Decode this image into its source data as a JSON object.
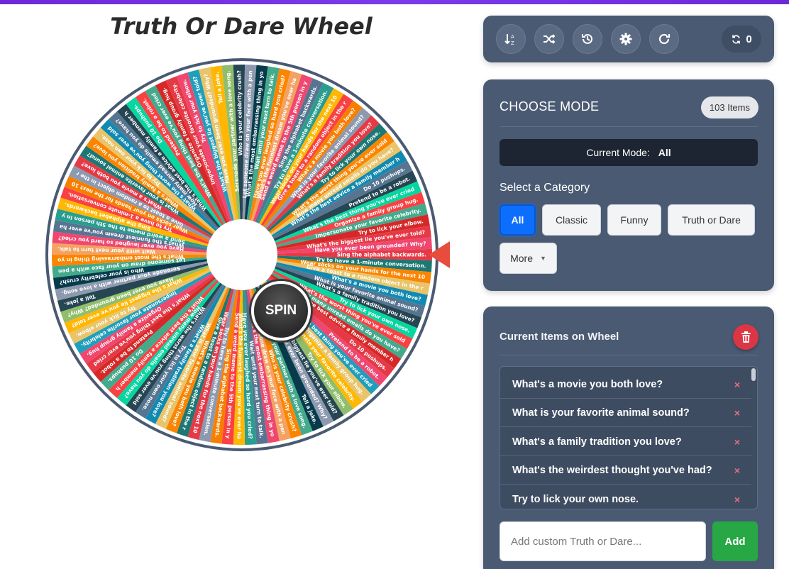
{
  "page_title": "Truth Or Dare Wheel",
  "wheel": {
    "spin_label": "SPIN",
    "segment_colors": [
      "#e63946",
      "#f4a261",
      "#e9c46a",
      "#2a9d8f",
      "#264653",
      "#f77f00",
      "#43aa8b",
      "#1d7874",
      "#ef476f",
      "#118ab2",
      "#ffb703",
      "#06d6a0",
      "#8d99ae",
      "#d62828",
      "#fb8500",
      "#219ebc",
      "#577590",
      "#90be6d",
      "#f94144",
      "#073b4c"
    ],
    "visible_labels": [
      "Sing the alphabet backwards.",
      "Try to have a 1-minute conversation.",
      "Wear socks on your hands for the next 10 minutes.",
      "Give a toast to a random object in the room.",
      "What's a movie you both love?",
      "What is your favorite animal sound?",
      "What's a family tradition you love?",
      "Try to lick your own nose.",
      "What's the worst thing you've ever sold to someone?",
      "How many unread emails do you have?",
      "What's the best advice a family member has given you?",
      "Do 10 pushups.",
      "Pretend to be a robot.",
      "What's the best thing you've ever cried about?",
      "Organize a family group hug.",
      "Impersonate your favorite celebrity.",
      "Try to lick your elbow.",
      "What's the biggest lie you've ever told?",
      "Have you ever been grounded? Why?",
      "Tell a joke.",
      "Serenade your partner with a love song.",
      "Who is your celebrity crush?",
      "Let someone draw on your face with a pen.",
      "What's the most embarrassing thing in your room?",
      "Wait until your next turn to talk.",
      "Have you ever laughed so hard you cried?",
      "What's the funniest dream you've ever had?",
      "Send a weird meme to the 5th person in your contact list."
    ]
  },
  "toolbar": {
    "buttons": [
      "sort",
      "shuffle",
      "history",
      "settings",
      "redo"
    ],
    "spin_count": "0"
  },
  "mode": {
    "heading": "CHOOSE MODE",
    "items_badge": "103 Items",
    "current_mode_label": "Current Mode:",
    "current_mode_value": "All",
    "category_label": "Select a Category",
    "categories": [
      "All",
      "Classic",
      "Funny",
      "Truth or Dare",
      "More"
    ],
    "active_category": "All"
  },
  "items_panel": {
    "heading": "Current Items on Wheel",
    "items": [
      "What's a movie you both love?",
      "What is your favorite animal sound?",
      "What's a family tradition you love?",
      "What's the weirdest thought you've had?",
      "Try to lick your own nose."
    ],
    "remove_glyph": "×",
    "input_placeholder": "Add custom Truth or Dare...",
    "add_label": "Add"
  }
}
